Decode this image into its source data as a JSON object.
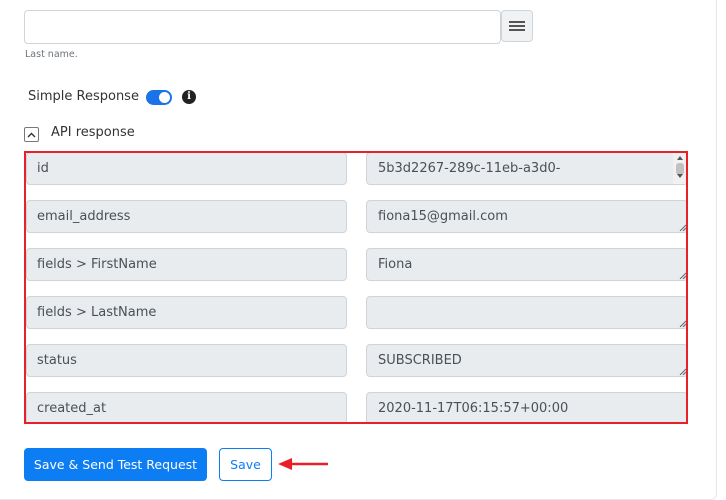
{
  "last_name": {
    "value": "",
    "hint": "Last name."
  },
  "simple_response": {
    "label": "Simple Response",
    "enabled": true,
    "info_icon": "info-circle-icon"
  },
  "api_response": {
    "label": "API response",
    "collapse_icon": "chevron-up-icon",
    "rows": [
      {
        "key": "id",
        "value": "5b3d2267-289c-11eb-a3d0-"
      },
      {
        "key": "email_address",
        "value": "fiona15@gmail.com"
      },
      {
        "key": "fields > FirstName",
        "value": "Fiona"
      },
      {
        "key": "fields > LastName",
        "value": ""
      },
      {
        "key": "status",
        "value": "SUBSCRIBED"
      },
      {
        "key": "created_at",
        "value": "2020-11-17T06:15:57+00:00"
      }
    ]
  },
  "buttons": {
    "save_and_test": "Save & Send Test Request",
    "save": "Save"
  },
  "colors": {
    "primary": "#0d7df3",
    "highlight": "#e8202a",
    "toggle_on": "#1a73e8",
    "field_bg": "#e9ecef"
  }
}
